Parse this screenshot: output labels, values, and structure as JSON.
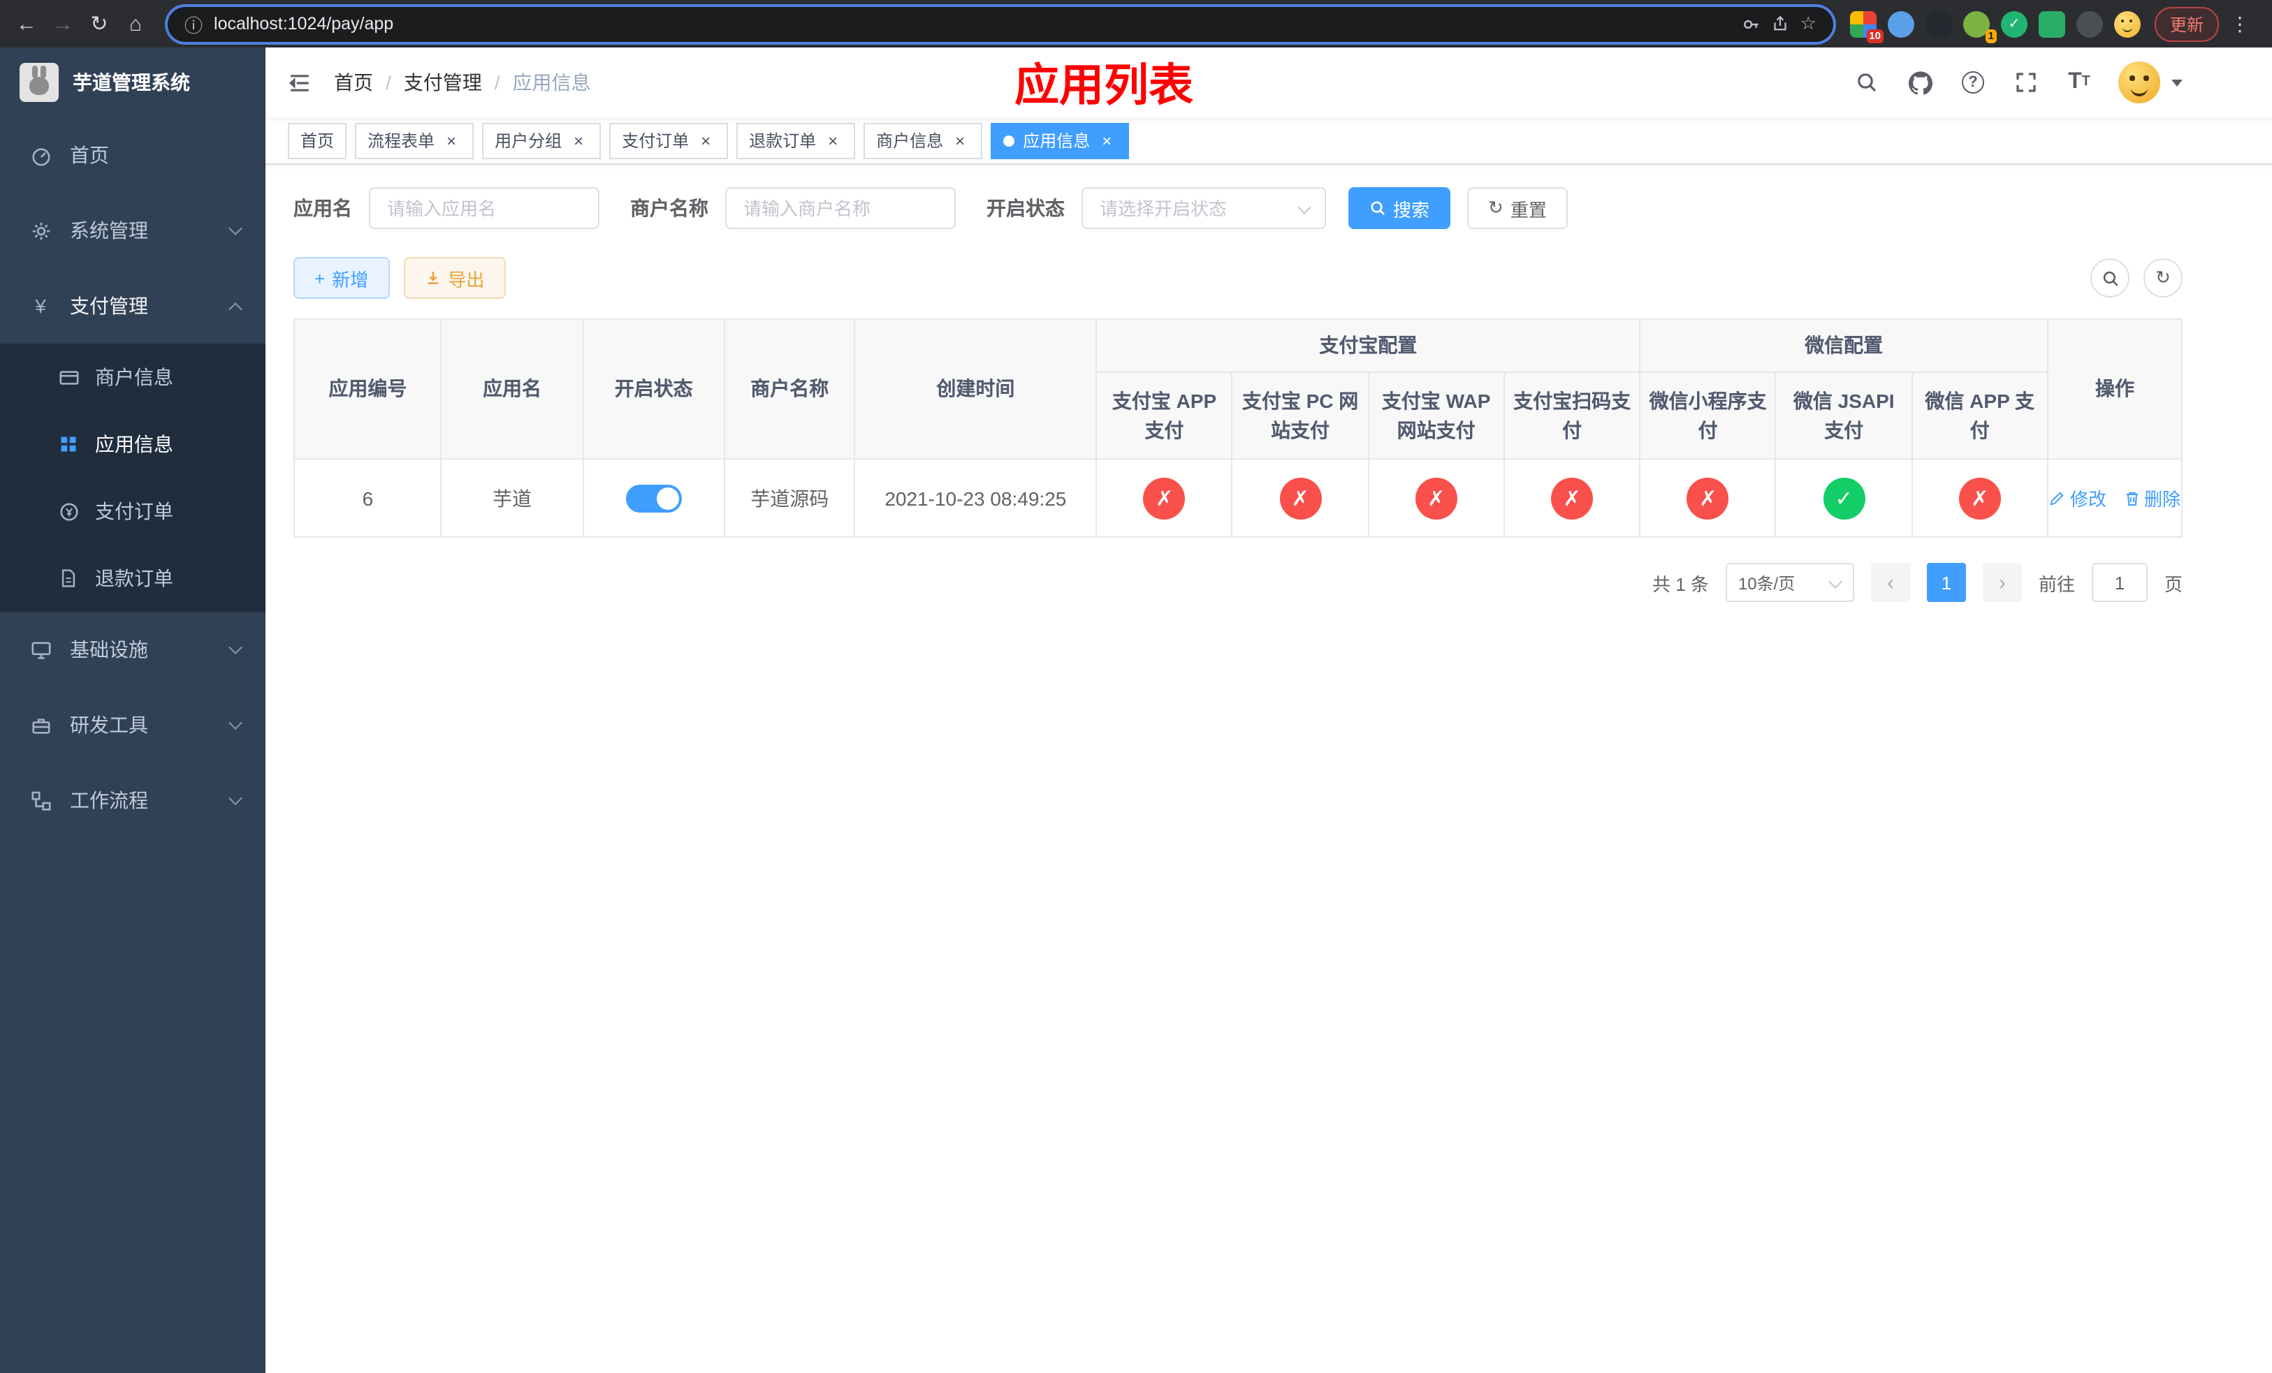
{
  "colors": {
    "accent": "#409eff",
    "danger": "#f9504b",
    "success": "#13ce66",
    "warning": "#e6a23c",
    "page_title_red": "#ff0000",
    "sidebar_bg": "#304156",
    "submenu_bg": "#1f2d3d"
  },
  "icons": {
    "back": "←",
    "forward": "→",
    "reload": "↻",
    "home": "⌂",
    "info": "ⓘ",
    "star": "☆",
    "more": "⋮",
    "close": "×",
    "check": "✓",
    "cross": "✗",
    "plus": "+",
    "yen": "¥"
  },
  "browser": {
    "url": "localhost:1024/pay/app",
    "update_label": "更新",
    "extension_badge_1": "10",
    "extension_badge_2": "1"
  },
  "sidebar": {
    "app_title": "芋道管理系统",
    "menu": [
      {
        "label": "首页"
      },
      {
        "label": "系统管理"
      },
      {
        "label": "支付管理"
      },
      {
        "label": "基础设施"
      },
      {
        "label": "研发工具"
      },
      {
        "label": "工作流程"
      }
    ],
    "pay_children": [
      {
        "label": "商户信息"
      },
      {
        "label": "应用信息"
      },
      {
        "label": "支付订单"
      },
      {
        "label": "退款订单"
      }
    ]
  },
  "navbar": {
    "breadcrumb": [
      "首页",
      "支付管理",
      "应用信息"
    ],
    "page_title": "应用列表"
  },
  "tabs": [
    {
      "label": "首页"
    },
    {
      "label": "流程表单"
    },
    {
      "label": "用户分组"
    },
    {
      "label": "支付订单"
    },
    {
      "label": "退款订单"
    },
    {
      "label": "商户信息"
    },
    {
      "label": "应用信息"
    }
  ],
  "filters": {
    "app_name_label": "应用名",
    "app_name_placeholder": "请输入应用名",
    "merchant_label": "商户名称",
    "merchant_placeholder": "请输入商户名称",
    "status_label": "开启状态",
    "status_placeholder": "请选择开启状态",
    "search_label": "搜索",
    "reset_label": "重置"
  },
  "toolbar": {
    "add_label": "新增",
    "export_label": "导出"
  },
  "table": {
    "col_app_id": "应用编号",
    "col_app_name": "应用名",
    "col_status": "开启状态",
    "col_merchant": "商户名称",
    "col_created": "创建时间",
    "group_alipay": "支付宝配置",
    "group_wechat": "微信配置",
    "sub_cols": [
      "支付宝 APP 支付",
      "支付宝 PC 网站支付",
      "支付宝 WAP 网站支付",
      "支付宝扫码支付",
      "微信小程序支付",
      "微信 JSAPI 支付",
      "微信 APP 支付"
    ],
    "col_actions": "操作",
    "row": {
      "id": "6",
      "name": "芋道",
      "enabled": true,
      "merchant": "芋道源码",
      "created": "2021-10-23 08:49:25",
      "statuses": [
        "cross",
        "cross",
        "cross",
        "cross",
        "cross",
        "check",
        "cross"
      ],
      "edit_label": "修改",
      "delete_label": "删除"
    }
  },
  "pagination": {
    "total_text": "共 1 条",
    "page_size": "10条/页",
    "current_page": "1",
    "goto_label": "前往",
    "goto_value": "1",
    "goto_unit": "页"
  }
}
